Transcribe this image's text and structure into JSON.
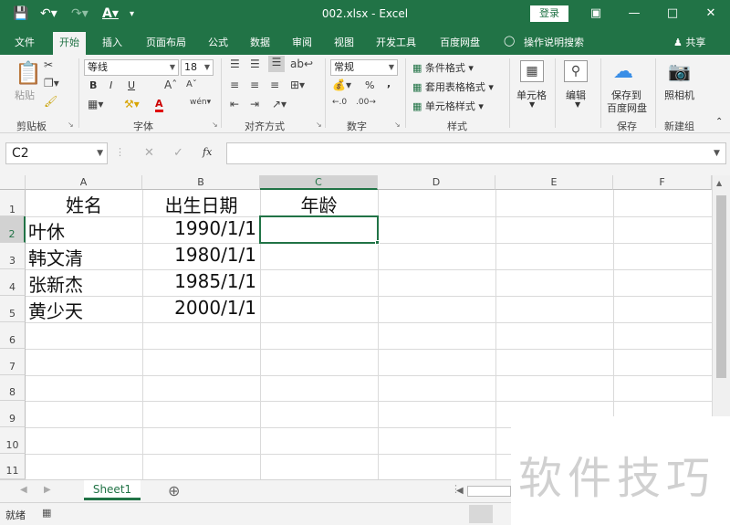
{
  "titlebar": {
    "doc_title": "002.xlsx  -  Excel",
    "login": "登录"
  },
  "tabs": [
    "文件",
    "开始",
    "插入",
    "页面布局",
    "公式",
    "数据",
    "审阅",
    "视图",
    "开发工具",
    "百度网盘"
  ],
  "tell_me": "操作说明搜索",
  "share": "共享",
  "ribbon": {
    "paste": "粘贴",
    "font_name": "等线",
    "font_size": "18",
    "bold": "B",
    "italic": "I",
    "underline": "U",
    "font_color_glyph": "A",
    "number_format": "常规",
    "percent": "%",
    "comma": ",",
    "conditional_format": "条件格式",
    "table_format": "套用表格格式",
    "cell_style": "单元格样式",
    "cells": "单元格",
    "edit": "编辑",
    "save_to_baidu_1": "保存到",
    "save_to_baidu_2": "百度网盘",
    "camera": "照相机",
    "groups": {
      "clipboard": "剪贴板",
      "font": "字体",
      "alignment": "对齐方式",
      "number": "数字",
      "styles": "样式",
      "save": "保存",
      "newgroup": "新建组"
    }
  },
  "formula_bar": {
    "name_box": "C2",
    "fx": "fx",
    "cancel": "✕",
    "confirm": "✓",
    "content": ""
  },
  "grid": {
    "columns": [
      "A",
      "B",
      "C",
      "D",
      "E",
      "F"
    ],
    "rows": [
      "1",
      "2",
      "3",
      "4",
      "5",
      "6",
      "7",
      "8",
      "9",
      "10",
      "11"
    ],
    "headers": {
      "name": "姓名",
      "birth": "出生日期",
      "age": "年龄"
    },
    "records": [
      {
        "name": "叶休",
        "birth": "1990/1/1"
      },
      {
        "name": "韩文清",
        "birth": "1980/1/1"
      },
      {
        "name": "张新杰",
        "birth": "1985/1/1"
      },
      {
        "name": "黄少天",
        "birth": "2000/1/1"
      }
    ],
    "selected_cell": "C2"
  },
  "sheet_tab": "Sheet1",
  "status": "就绪",
  "watermark": "软件技巧",
  "colors": {
    "accent": "#217346",
    "ribbon": "#f3f3f3"
  }
}
